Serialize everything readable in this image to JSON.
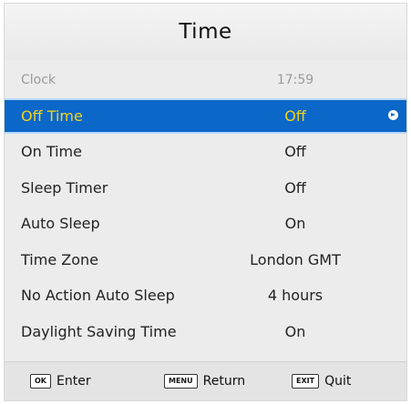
{
  "title": "Time",
  "rows": [
    {
      "label": "Clock",
      "value": "17:59"
    },
    {
      "label": "Off Time",
      "value": "Off"
    },
    {
      "label": "On Time",
      "value": "Off"
    },
    {
      "label": "Sleep Timer",
      "value": "Off"
    },
    {
      "label": "Auto Sleep",
      "value": "On"
    },
    {
      "label": "Time Zone",
      "value": "London GMT"
    },
    {
      "label": "No Action Auto Sleep",
      "value": "4 hours"
    },
    {
      "label": "Daylight Saving Time",
      "value": "On"
    }
  ],
  "footer": {
    "enter": {
      "key": "OK",
      "label": "Enter"
    },
    "return": {
      "key": "MENU",
      "label": "Return"
    },
    "quit": {
      "key": "EXIT",
      "label": "Quit"
    }
  },
  "colors": {
    "selected_bg": "#0b67c8",
    "selected_text": "#f2d21e",
    "panel_bg": "#ececec"
  }
}
